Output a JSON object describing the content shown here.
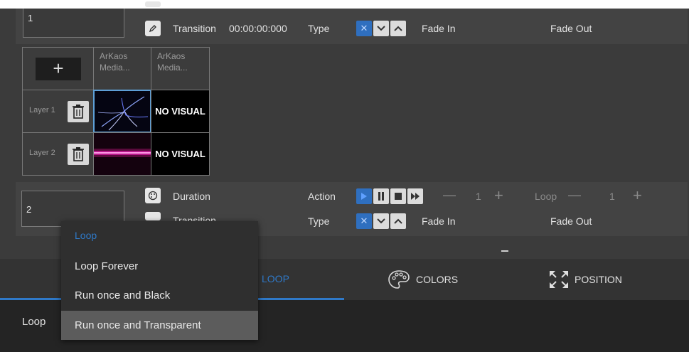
{
  "cue1": {
    "number": "1",
    "transition_label": "Transition",
    "transition_time": "00:00:00:000",
    "type_label": "Type",
    "fade_in_label": "Fade In",
    "fade_out_label": "Fade Out"
  },
  "layer_grid": {
    "add_symbol": "+",
    "columns": [
      "ArKaos Media...",
      "ArKaos Media..."
    ],
    "rows": [
      {
        "label": "Layer 1",
        "visual": "NO VISUAL"
      },
      {
        "label": "Layer 2",
        "visual": "NO VISUAL"
      }
    ]
  },
  "cue2": {
    "number": "2",
    "duration_label": "Duration",
    "transition_label": "Transition",
    "action_label": "Action",
    "type_label": "Type",
    "repeat_count": "1",
    "loop_label": "Loop",
    "loop_count": "1",
    "fade_in_label": "Fade In",
    "fade_out_label": "Fade Out"
  },
  "tabs": [
    {
      "label": "LOOP",
      "active": true
    },
    {
      "label": "COLORS",
      "icon": "palette-icon"
    },
    {
      "label": "POSITION",
      "icon": "expand-icon"
    }
  ],
  "bottom": {
    "loop_label": "Loop"
  },
  "dropdown": {
    "selected": "Loop",
    "options": [
      "Loop Forever",
      "Run once and Black",
      "Run once and Transparent"
    ],
    "highlighted": "Run once and Transparent"
  },
  "colors": {
    "accent": "#2f79c8",
    "panel": "#434343",
    "background": "#3b3b3b"
  }
}
